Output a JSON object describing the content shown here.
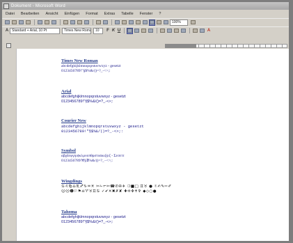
{
  "window": {
    "title": "Dokument - Microsoft Word"
  },
  "menu": [
    "Datei",
    "Bearbeiten",
    "Ansicht",
    "Einfügen",
    "Format",
    "Extras",
    "Tabelle",
    "Fenster",
    "?"
  ],
  "toolbar": {
    "zoom_value": "100%",
    "style_value": "Standard + Arial, 10 Pt",
    "font_value": "Times New Roman",
    "size_value": "10"
  },
  "fonts": [
    {
      "name": "Times New Roman",
      "line1": "abcdefghijklmnopqrstuvwxyz - gesetzt",
      "line2": "0123456789!\"§$%&/()=?_-<>;:"
    },
    {
      "name": "Arial",
      "line1": "abcdefghijklmnopqrstuvwxyz - gesetzt",
      "line2": "0123456789!\"§$%&/()=?_-<>;:"
    },
    {
      "name": "Courier New",
      "line1": "abcdefghijklmnopqrstuvwxyz - gesetzt",
      "line2": "0123456789!\"§$%&/()=?_-<>;:"
    },
    {
      "name": "Symbol",
      "line1": "αβχδεφγηιϕκλμνοπθρστυϖωξψζ - Σεσεττ",
      "line2": "0123456789!∀§∃%&/()=?_−<>;:"
    },
    {
      "name": "Wingdings",
      "line1": "♋♌♍♎♏♐♑♒♓ ✂✁✃✄☎✆✇✈ ❍■□ ♊♉ ● ✌✍✎✏✐",
      "line2": "☺☹☻⚐⚑☠♈♉♊♋ ✓✔✕✖✗✘ ✚✛✜✝✞ ◆◇○●"
    },
    {
      "name": "Tahoma",
      "line1": "abcdefghijklmnopqrstuvwxyz - gesetzt",
      "line2": "0123456789!\"§$%&/()=?_-<>;:"
    }
  ]
}
